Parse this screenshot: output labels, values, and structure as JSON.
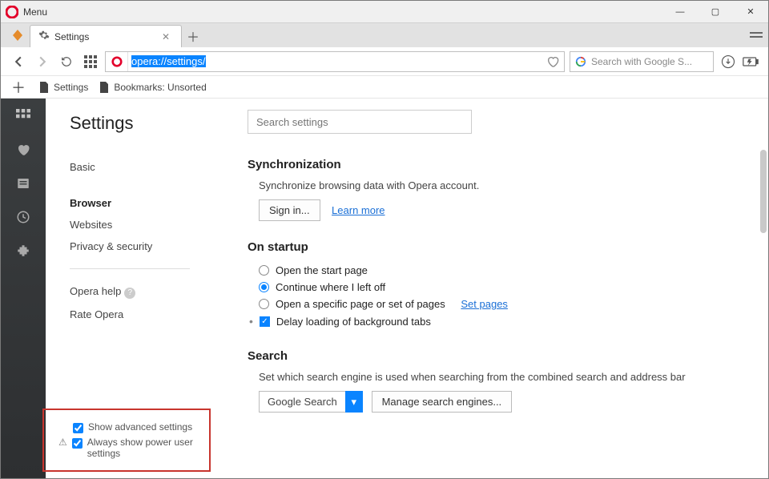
{
  "titlebar": {
    "menu_label": "Menu"
  },
  "tab": {
    "title": "Settings"
  },
  "address": {
    "url": "opera://settings/"
  },
  "search_engine_box": {
    "placeholder": "Search with Google S..."
  },
  "bookmarks_bar": {
    "settings": "Settings",
    "unsorted": "Bookmarks: Unsorted"
  },
  "sidebar": {
    "title": "Settings",
    "nav": [
      "Basic",
      "Browser",
      "Websites",
      "Privacy & security"
    ],
    "help": "Opera help",
    "rate": "Rate Opera",
    "show_adv": "Show advanced settings",
    "power_user": "Always show power user settings"
  },
  "content": {
    "search_placeholder": "Search settings",
    "sync": {
      "title": "Synchronization",
      "desc": "Synchronize browsing data with Opera account.",
      "signin": "Sign in...",
      "learn": "Learn more"
    },
    "startup": {
      "title": "On startup",
      "opt1": "Open the start page",
      "opt2": "Continue where I left off",
      "opt3": "Open a specific page or set of pages",
      "opt3_link": "Set pages",
      "opt4": "Delay loading of background tabs"
    },
    "search": {
      "title": "Search",
      "desc": "Set which search engine is used when searching from the combined search and address bar",
      "selected": "Google Search",
      "manage": "Manage search engines..."
    }
  }
}
